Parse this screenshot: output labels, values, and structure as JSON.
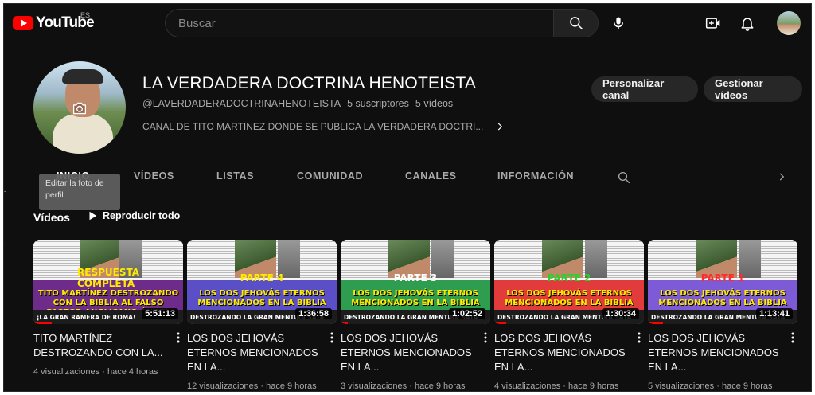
{
  "topbar": {
    "logo_text": "YouTube",
    "region": "ES",
    "search_placeholder": "Buscar"
  },
  "channel": {
    "name": "LA VERDADERA DOCTRINA HENOTEISTA",
    "handle": "@LAVERDADERADOCTRINAHENOTEISTA",
    "subscribers": "5 suscriptores",
    "videos_count": "5 vídeos",
    "description": "CANAL DE TITO MARTINEZ DONDE SE PUBLICA LA VERDADERA DOCTRI...",
    "customize_label": "Personalizar canal",
    "manage_label": "Gestionar vídeos"
  },
  "tabs": [
    "INICIO",
    "VÍDEOS",
    "LISTAS",
    "COMUNIDAD",
    "CANALES",
    "INFORMACIÓN"
  ],
  "tooltip": "Editar la foto de perfil",
  "section": {
    "title": "Vídeos",
    "play_all": "Reproducir todo"
  },
  "videos": [
    {
      "title": "TITO MARTÍNEZ DESTROZANDO CON LA...",
      "duration": "5:51:13",
      "views": "4 visualizaciones",
      "age": "hace 4 horas",
      "thumb_part": "RESPUESTA COMPLETA",
      "thumb_title": "TITO MARTÍNEZ DESTROZANDO CON LA BIBLIA AL FALSO PASTOR ANGLICANO ÁNGEL GARCÍA",
      "thumb_strip": "¡LA GRAN RAMERA DE ROMA!",
      "band_color": "#6d2b8a",
      "part_color": "#ffea00",
      "progress": 0.12
    },
    {
      "title": "LOS DOS JEHOVÁS ETERNOS MENCIONADOS EN LA...",
      "duration": "1:36:58",
      "views": "12 visualizaciones",
      "age": "hace 9 horas",
      "thumb_part": "PARTE 4",
      "thumb_title": "LOS DOS JEHOVÁS ETERNOS MENCIONADOS EN LA BIBLIA",
      "thumb_strip": "DESTROZANDO LA GRAN MENTIRA SATÁ",
      "band_color": "#5b4fc7",
      "part_color": "#ffea00",
      "progress": 0.0
    },
    {
      "title": "LOS DOS JEHOVÁS ETERNOS MENCIONADOS EN LA...",
      "duration": "1:02:52",
      "views": "3 visualizaciones",
      "age": "hace 9 horas",
      "thumb_part": "PARTE 3",
      "thumb_title": "LOS DOS JEHOVÁS ETERNOS MENCIONADOS EN LA BIBLIA",
      "thumb_strip": "DESTROZANDO LA GRAN MENTIRA SATA",
      "band_color": "#2e9d4f",
      "part_color": "#ffffff",
      "progress": 0.05
    },
    {
      "title": "LOS DOS JEHOVÁS ETERNOS MENCIONADOS EN LA...",
      "duration": "1:30:34",
      "views": "4 visualizaciones",
      "age": "hace 9 horas",
      "thumb_part": "PARTE 2",
      "thumb_title": "LOS DOS JEHOVÁS ETERNOS MENCIONADOS EN LA BIBLIA",
      "thumb_strip": "DESTROZANDO LA GRAN MENTIRA SATA",
      "band_color": "#e23b3b",
      "part_color": "#2bd12b",
      "progress": 0.08
    },
    {
      "title": "LOS DOS JEHOVÁS ETERNOS MENCIONADOS EN LA...",
      "duration": "1:13:41",
      "views": "5 visualizaciones",
      "age": "hace 9 horas",
      "thumb_part": "PARTE 1",
      "thumb_title": "LOS DOS JEHOVÁS ETERNOS MENCIONADOS EN LA BIBLIA",
      "thumb_strip": "DESTROZANDO LA GRAN MENTIRA SATÁ",
      "band_color": "#7d5bd6",
      "part_color": "#ff2b2b",
      "progress": 0.1
    }
  ],
  "colors": {
    "background": "#0f0f0f",
    "brand_red": "#ff0000",
    "pill_bg": "#272727",
    "muted_text": "#aaaaaa"
  },
  "icons": [
    "youtube-logo-icon",
    "search-icon",
    "mic-icon",
    "create-video-icon",
    "bell-icon",
    "account-avatar-icon",
    "camera-icon",
    "chevron-right-icon",
    "tab-search-icon",
    "tabs-next-icon",
    "play-icon",
    "more-vert-icon"
  ]
}
